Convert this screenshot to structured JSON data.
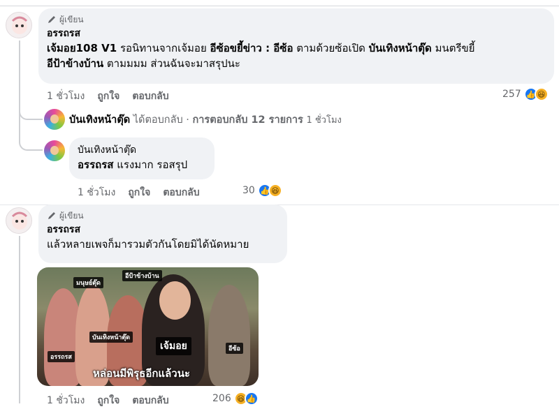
{
  "comment1": {
    "author_tag": "ผู้เขียน",
    "name": "อรรถรส",
    "t1": "เจ้มอย108 V1",
    "t2": " รอนิทานจากเจ้มอย ",
    "t3": "อีซ้อขยี้ข่าว : อีซ้อ",
    "t4": " ตามด้วยซ้อเปิด ",
    "t5": "บันเทิงหน้าตุ๊ด",
    "t6": " มนตรีขยี้",
    "t7": "อีป้าข้างบ้าน",
    "t8": " ตามมมม ส่วนฉันจะมาสรุปนะ",
    "time": "1 ชั่วโมง",
    "like": "ถูกใจ",
    "reply": "ตอบกลับ",
    "reaction_count": "257"
  },
  "reply_summary": {
    "name": "บันเทิงหน้าตุ๊ด",
    "text1": " ได้ตอบกลับ · ",
    "text2": "การตอบกลับ 12 รายการ",
    "time": "1 ชั่วโมง"
  },
  "reply1": {
    "name": "บันเทิงหน้าตุ๊ด",
    "mention": "อรรถรส",
    "text": " แรงมาก รอสรุป",
    "time": "1 ชั่วโมง",
    "like": "ถูกใจ",
    "reply": "ตอบกลับ",
    "reaction_count": "30"
  },
  "comment2": {
    "author_tag": "ผู้เขียน",
    "name": "อรรถรส",
    "text": "แล้วหลายเพจก็มารวมตัวกันโดยมิได้นัดหมาย",
    "time": "1 ชั่วโมง",
    "like": "ถูกใจ",
    "reply": "ตอบกลับ",
    "reaction_count": "206"
  },
  "meme": {
    "label_1": "มนุษย์ตุ๊ด",
    "label_2": "อีป้าข้างบ้าน",
    "label_3": "บันเทิงหน้าตุ๊ด",
    "label_4": "เจ้มอย",
    "label_5": "อีซ้อ",
    "label_6": "อรรถรส",
    "caption": "หล่อนมีพิรุธอีกแล้วนะ"
  },
  "colors": {
    "link_blue": "#1877f2",
    "bubble": "#f0f2f5",
    "meta": "#65676b"
  },
  "icons": [
    "pencil-icon",
    "like-icon",
    "haha-icon"
  ]
}
